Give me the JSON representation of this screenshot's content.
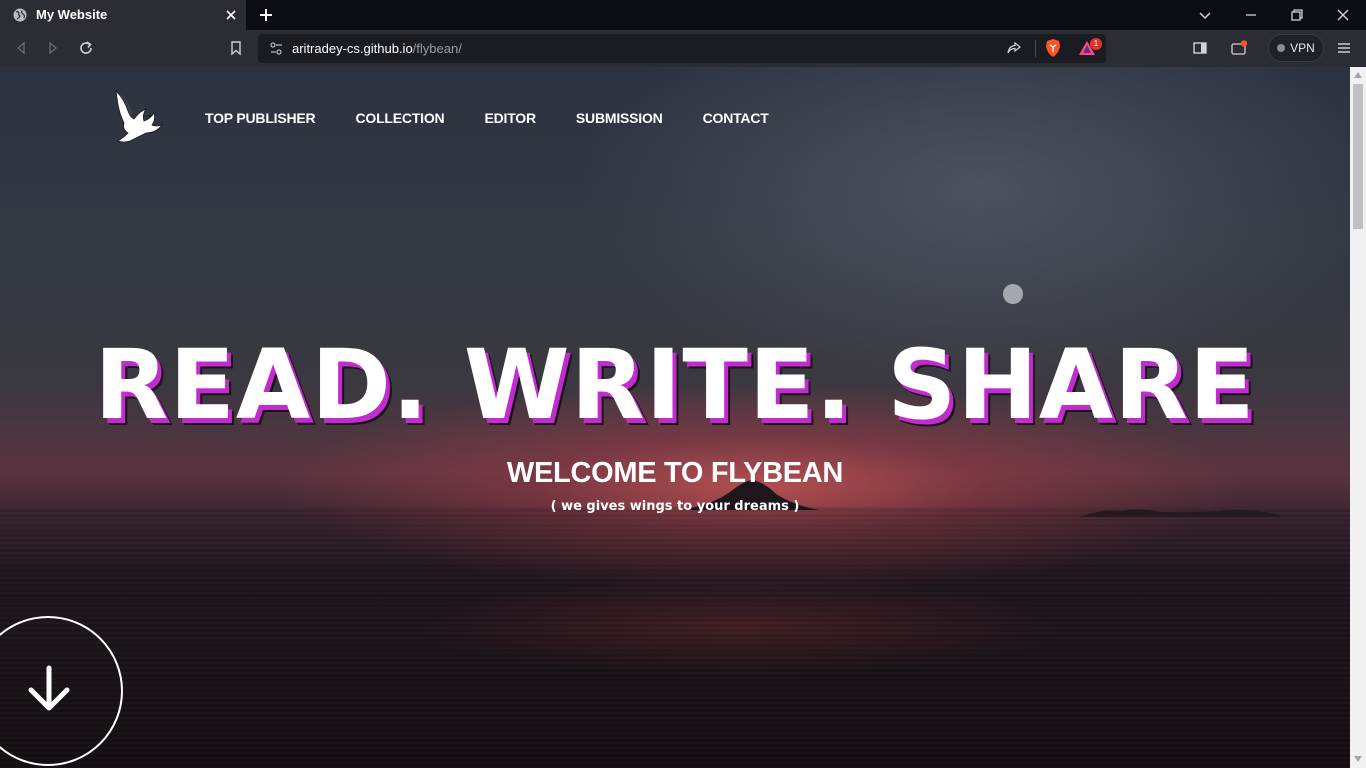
{
  "browser": {
    "tab_title": "My Website",
    "url_host": "aritradey-cs.github.io",
    "url_path": "/flybean/",
    "vpn_label": "VPN",
    "notification_count": "1"
  },
  "page": {
    "nav_items": [
      "TOP PUBLISHER",
      "COLLECTION",
      "EDITOR",
      "SUBMISSION",
      "CONTACT"
    ],
    "headline": "READ. WRITE. SHARE",
    "welcome": "WELCOME TO FLYBEAN",
    "tagline": "( we gives wings to your dreams )",
    "headline_shadow_color": "#c22bd0",
    "icons": {
      "logo": "dove-icon",
      "scroll": "arrow-down-icon"
    }
  }
}
